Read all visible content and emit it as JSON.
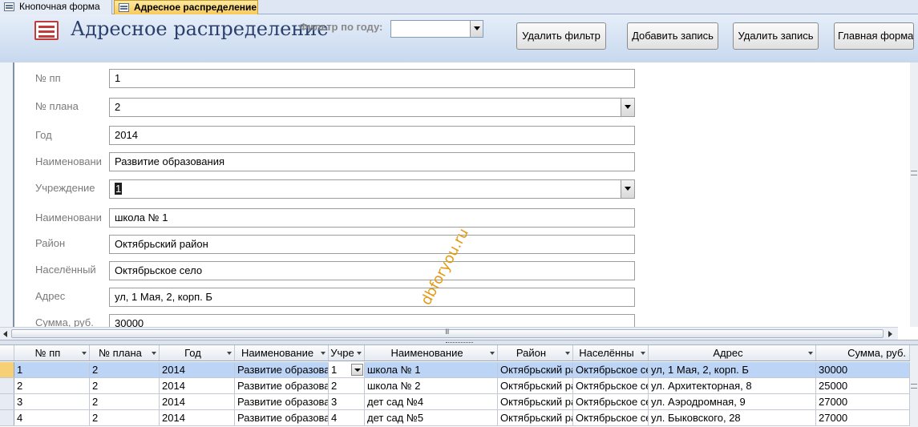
{
  "tabs": [
    {
      "label": "Кнопочная форма",
      "active": false
    },
    {
      "label": "Адресное распределение",
      "active": true
    }
  ],
  "header": {
    "title": "Адресное распределение",
    "filter_label": "Фильтр по году:",
    "filter_value": "",
    "buttons": {
      "delete_filter": "Удалить фильтр",
      "add_record": "Добавить запись",
      "delete_record": "Удалить запись",
      "main_form": "Главная форма"
    }
  },
  "form": {
    "fields": [
      {
        "label": "№ пп",
        "value": "1"
      },
      {
        "label": "№ плана",
        "value": "2"
      },
      {
        "label": "Год",
        "value": "2014"
      },
      {
        "label": "Наименовани",
        "value": "Развитие образования"
      },
      {
        "label": "Учреждение",
        "value": "1"
      },
      {
        "label": "Наименовани",
        "value": "школа № 1"
      },
      {
        "label": "Район",
        "value": "Октябрьский район"
      },
      {
        "label": "Населённый",
        "value": "Октябрьское село"
      },
      {
        "label": "Адрес",
        "value": "ул, 1 Мая, 2, корп. Б"
      },
      {
        "label": "Сумма, руб.",
        "value": "30000"
      }
    ]
  },
  "watermark": "dbforyou.ru",
  "datasheet": {
    "columns": [
      "№ пп",
      "№ плана",
      "Год",
      "Наименование",
      "Учре",
      "Наименование",
      "Район",
      "Населённы",
      "Адрес",
      "Сумма, руб."
    ],
    "rows": [
      [
        "1",
        "2",
        "2014",
        "Развитие образования",
        "1",
        "школа № 1",
        "Октябрьский район",
        "Октябрьское село",
        "ул, 1 Мая, 2, корп. Б",
        "30000"
      ],
      [
        "2",
        "2",
        "2014",
        "Развитие образования",
        "2",
        "школа № 2",
        "Октябрьский район",
        "Октябрьское село",
        "ул. Архитекторная, 8",
        "25000"
      ],
      [
        "3",
        "2",
        "2014",
        "Развитие образования",
        "3",
        "дет сад №4",
        "Октябрьский район",
        "Октябрьское село",
        "ул. Аэродромная, 9",
        "27000"
      ],
      [
        "4",
        "2",
        "2014",
        "Развитие образования",
        "4",
        "дет сад  №5",
        "Октябрьский район",
        "Октябрьское село",
        "ул. Быковского, 28",
        "27000"
      ]
    ]
  }
}
